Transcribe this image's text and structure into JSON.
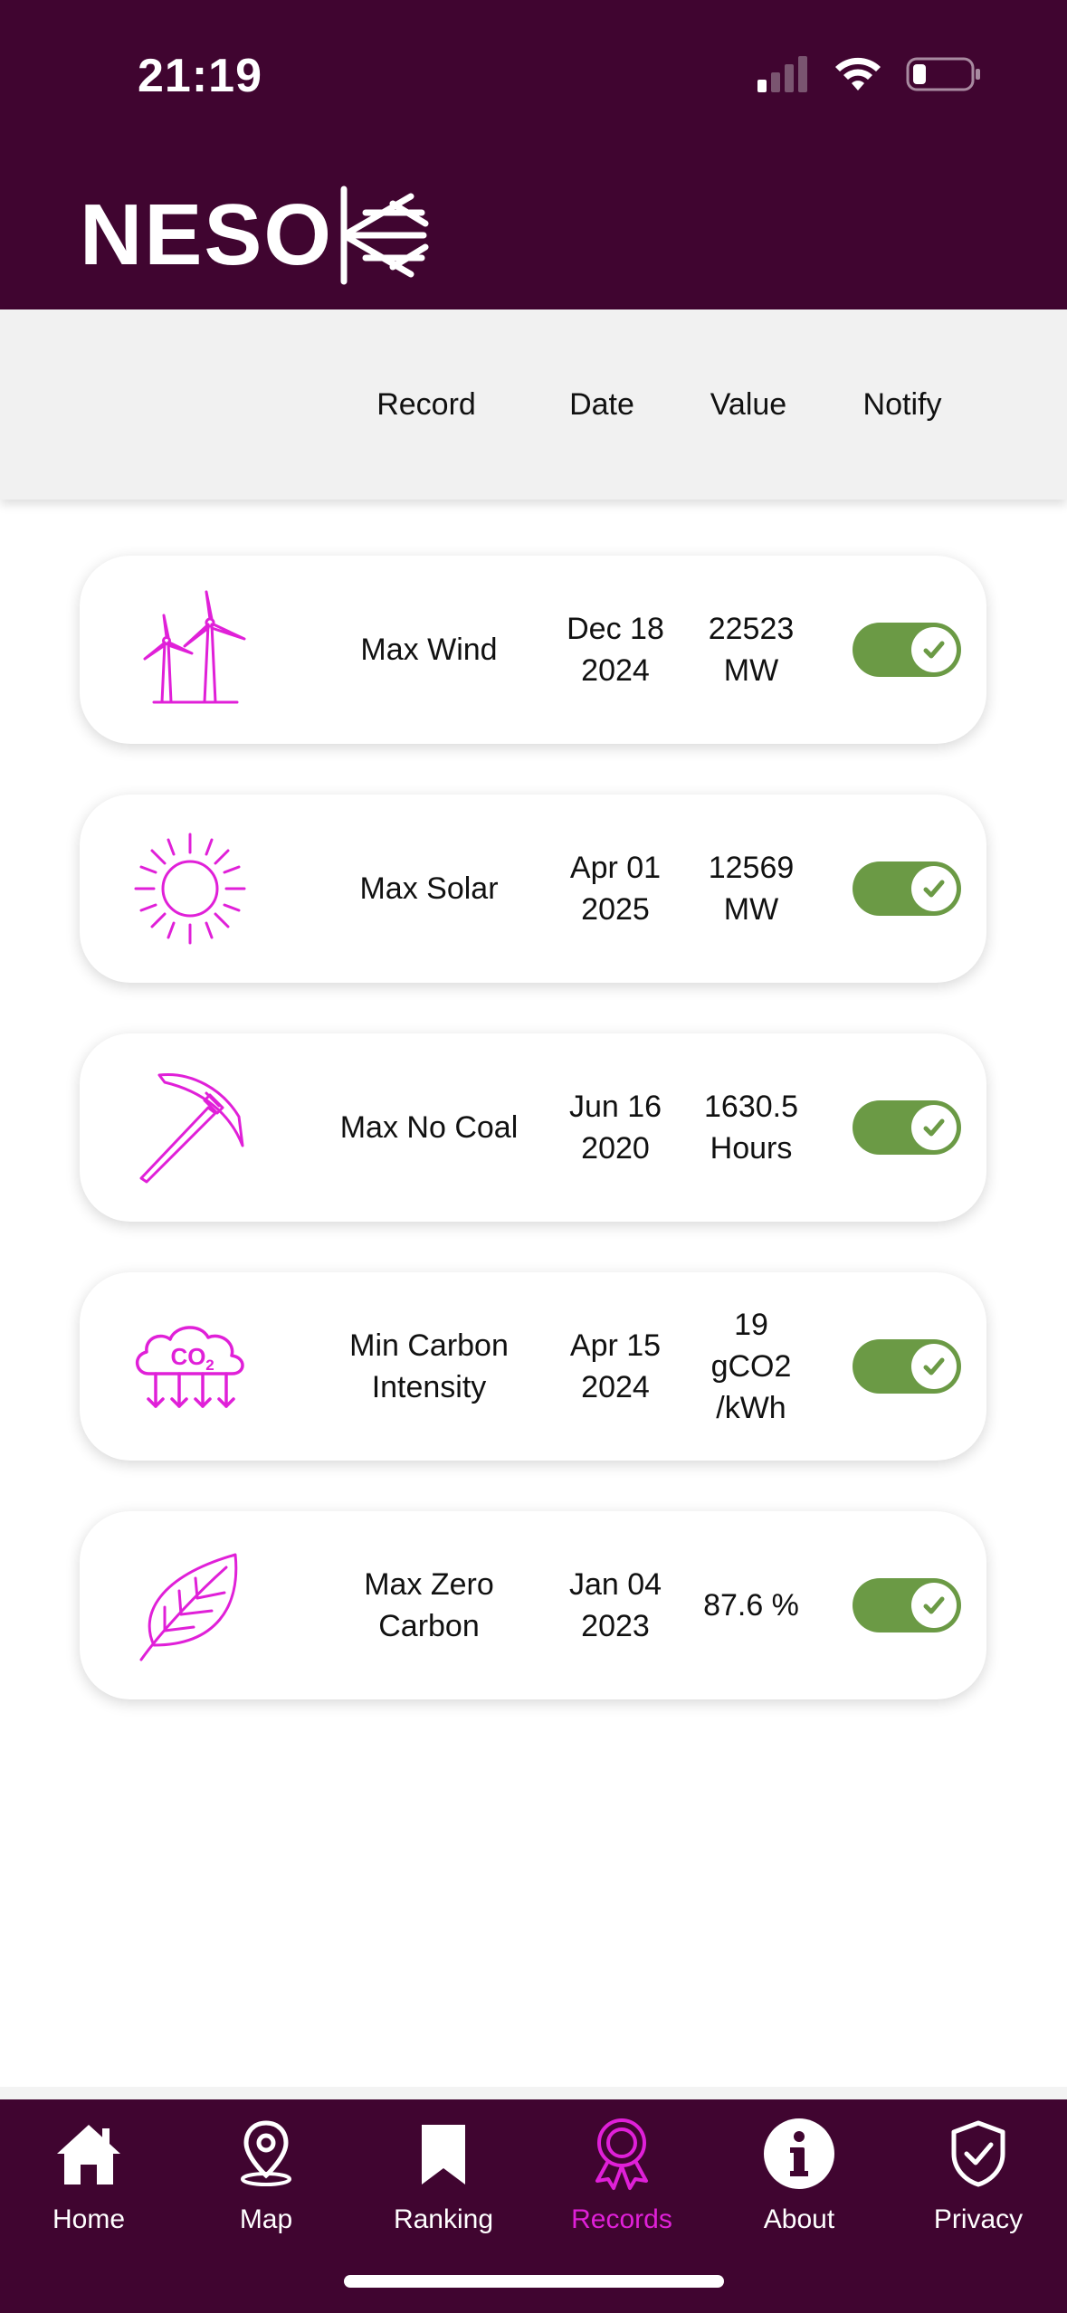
{
  "status_bar": {
    "time": "21:19"
  },
  "app": {
    "logo_text": "NESO"
  },
  "columns": {
    "record": "Record",
    "date": "Date",
    "value": "Value",
    "notify": "Notify"
  },
  "records": [
    {
      "icon": "wind-turbine-icon",
      "name": "Max Wind",
      "date": "Dec 18\n2024",
      "value": "22523\nMW",
      "notify": true
    },
    {
      "icon": "sun-icon",
      "name": "Max Solar",
      "date": "Apr 01\n2025",
      "value": "12569\nMW",
      "notify": true
    },
    {
      "icon": "pickaxe-icon",
      "name": "Max No Coal",
      "date": "Jun 16\n2020",
      "value": "1630.5\nHours",
      "notify": true
    },
    {
      "icon": "co2-cloud-icon",
      "name": "Min Carbon\nIntensity",
      "date": "Apr 15\n2024",
      "value": "19\ngCO2\n/kWh",
      "notify": true
    },
    {
      "icon": "leaf-icon",
      "name": "Max Zero\nCarbon",
      "date": "Jan 04\n2023",
      "value": "87.6 %",
      "notify": true
    }
  ],
  "nav": {
    "items": [
      {
        "label": "Home",
        "icon": "home-icon",
        "active": false
      },
      {
        "label": "Map",
        "icon": "map-pin-icon",
        "active": false
      },
      {
        "label": "Ranking",
        "icon": "bookmark-icon",
        "active": false
      },
      {
        "label": "Records",
        "icon": "award-ribbon-icon",
        "active": true
      },
      {
        "label": "About",
        "icon": "info-icon",
        "active": false
      },
      {
        "label": "Privacy",
        "icon": "shield-check-icon",
        "active": false
      }
    ]
  },
  "colors": {
    "brand": "#400530",
    "accent": "#e020d8",
    "toggle_on": "#6b9a45"
  }
}
